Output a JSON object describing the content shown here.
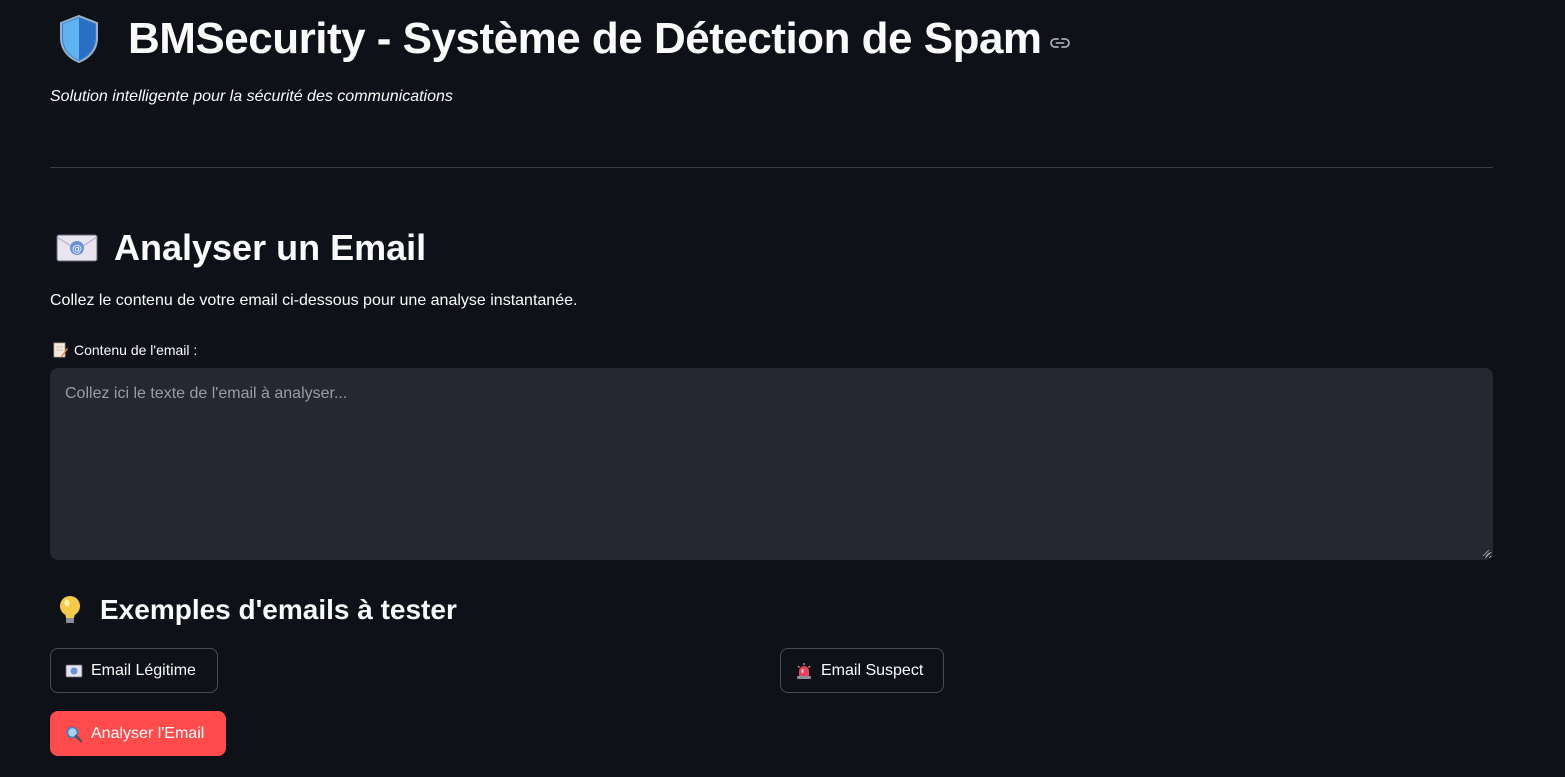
{
  "header": {
    "title": "BMSecurity - Système de Détection de Spam",
    "subtitle": "Solution intelligente pour la sécurité des communications",
    "icon": "shield-icon",
    "anchor_icon": "link-icon"
  },
  "analyze_section": {
    "title": "Analyser un Email",
    "icon": "email-envelope-icon",
    "instructions": "Collez le contenu de votre email ci-dessous pour une analyse instantanée.",
    "field_label": "Contenu de l'email :",
    "field_icon": "memo-icon",
    "textarea_value": "",
    "textarea_placeholder": "Collez ici le texte de l'email à analyser..."
  },
  "examples_section": {
    "title": "Exemples d'emails à tester",
    "icon": "light-bulb-icon",
    "buttons": [
      {
        "label": "Email Légitime",
        "icon": "email-icon"
      },
      {
        "label": "Email Suspect",
        "icon": "siren-icon"
      }
    ]
  },
  "actions": {
    "analyze_label": "Analyser l'Email",
    "analyze_icon": "magnifier-icon"
  },
  "colors": {
    "background": "#0e1117",
    "input_background": "#262730",
    "primary": "#ff4b4b",
    "text": "#fafafa",
    "divider": "#3a3d45"
  }
}
